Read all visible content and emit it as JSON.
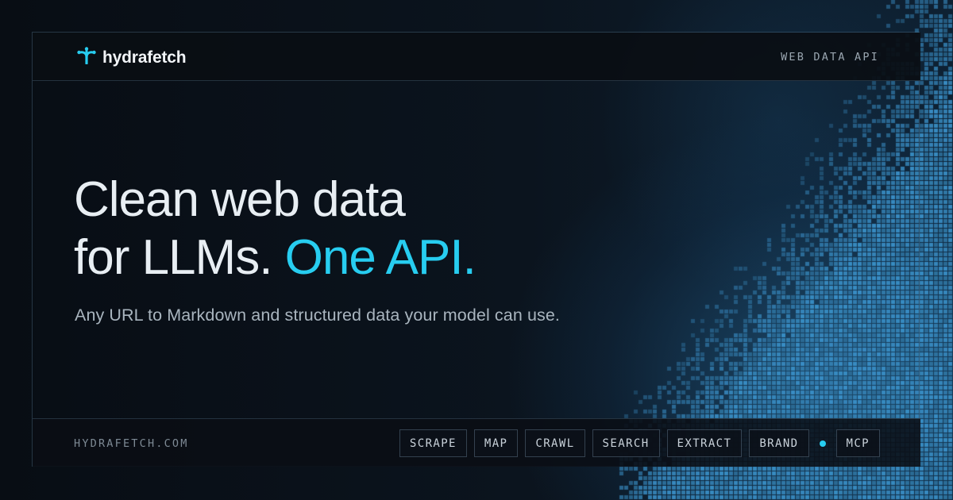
{
  "brand": {
    "name": "hydrafetch",
    "icon": "hydra-logo-icon",
    "accent": "#27cdf0"
  },
  "header": {
    "tagline": "WEB DATA API"
  },
  "hero": {
    "headline_line1": "Clean web data",
    "headline_line2_plain": "for LLMs.",
    "headline_line2_accent": "One API.",
    "subhead": "Any URL to Markdown and structured data your model can use."
  },
  "footer": {
    "domain": "HYDRAFETCH.COM",
    "chips": [
      "SCRAPE",
      "MAP",
      "CRAWL",
      "SEARCH",
      "EXTRACT",
      "BRAND"
    ],
    "highlight_chip": "MCP"
  },
  "colors": {
    "background": "#0a1018",
    "text": "#e8eef3",
    "accent": "#27cdf0",
    "muted": "#9aa6b0"
  }
}
